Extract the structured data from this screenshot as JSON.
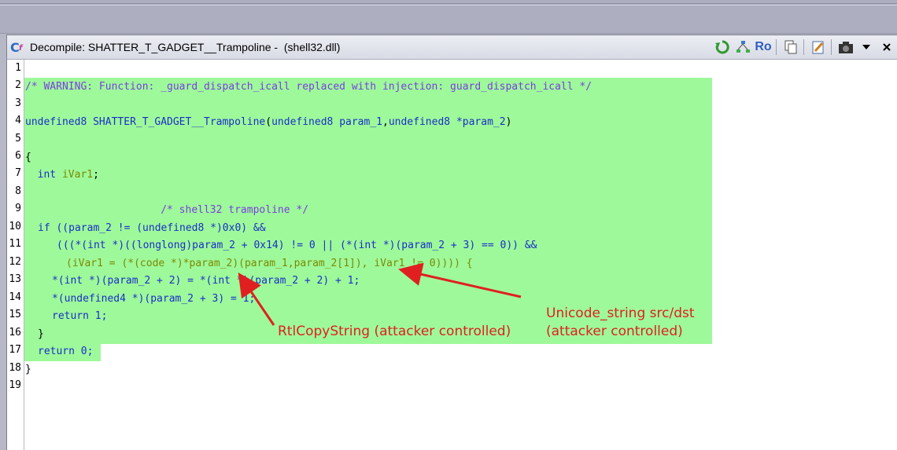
{
  "window": {
    "title": "Decompile: SHATTER_T_GADGET__Trampoline -  (shell32.dll)",
    "tool_ro_label": "Ro"
  },
  "line_numbers": [
    "1",
    "2",
    "3",
    "4",
    "5",
    "6",
    "7",
    "8",
    "9",
    "10",
    "11",
    "12",
    "13",
    "14",
    "15",
    "16",
    "17",
    "18",
    "19"
  ],
  "code": {
    "l2_comment": "/* WARNING: Function: _guard_dispatch_icall replaced with injection: guard_dispatch_icall */",
    "l4_type": "undefined8",
    "l4_func": "SHATTER_T_GADGET__Trampoline",
    "l4_rest_a": "(",
    "l4_ptype1": "undefined8",
    "l4_p1": "param_1",
    "l4_comma": ",",
    "l4_ptype2": "undefined8",
    "l4_p2": "*param_2",
    "l4_close": ")",
    "l6": "{",
    "l7_type": "int",
    "l7_var": "iVar1",
    "l7_semi": ";",
    "l9_comment": "/* shell32 trampoline */",
    "l10": "if ((param_2 != (undefined8 *)0x0) &&",
    "l11": "(((*(int *)((longlong)param_2 + 0x14) != 0 || (*(int *)(param_2 + 3) == 0)) &&",
    "l12": "(iVar1 = (*(code *)*param_2)(param_1,param_2[1]), iVar1 != 0)))) {",
    "l13": "*(int *)(param_2 + 2) = *(int *)(param_2 + 2) + 1;",
    "l14": "*(undefined4 *)(param_2 + 3) = 1;",
    "l15": "return 1;",
    "l16": "}",
    "l17": "return 0;",
    "l18": "}"
  },
  "annotations": {
    "unicode_line1": "Unicode_string src/dst",
    "unicode_line2": "(attacker controlled)",
    "rtl": "RtlCopyString (attacker controlled)"
  },
  "colors": {
    "highlight": "#9ef99a",
    "annotation": "#e02020"
  }
}
